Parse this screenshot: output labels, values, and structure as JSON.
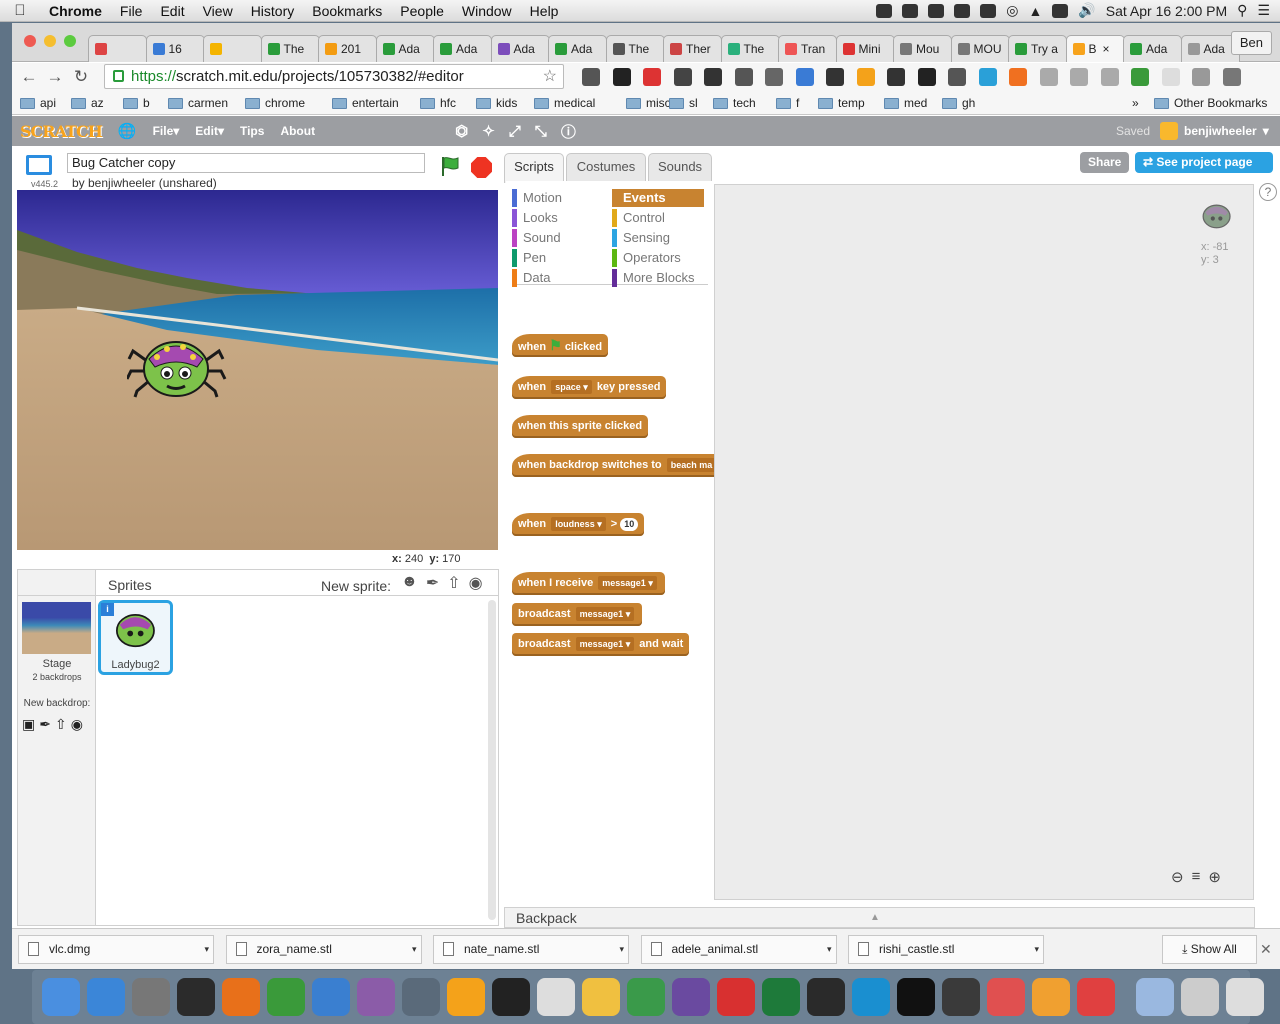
{
  "menubar": {
    "app": "Chrome",
    "items": [
      "File",
      "Edit",
      "View",
      "History",
      "Bookmarks",
      "People",
      "Window",
      "Help"
    ],
    "clock": "Sat Apr 16  2:00 PM"
  },
  "browser": {
    "tabs": [
      "",
      "16",
      "",
      "The",
      "201",
      "Ada",
      "Ada",
      "Ada",
      "Ada",
      "The",
      "Ther",
      "The",
      "Tran",
      "Mini",
      "Mou",
      "MOU",
      "Try a",
      "B",
      "Ada",
      "Ada"
    ],
    "tab_colors": [
      "#d44",
      "#3a7bd5",
      "#f4b400",
      "#2a9c3b",
      "#f39c12",
      "#2a9c3b",
      "#2a9c3b",
      "#7c4dbb",
      "#2a9c3b",
      "#555",
      "#c44",
      "#2ab07c",
      "#e55",
      "#d33",
      "#777",
      "#777",
      "#2a9c3b",
      "#f7a31c",
      "#2a9c3b",
      "#999"
    ],
    "active_tab": 17,
    "profile": "Ben",
    "url_scheme": "https://",
    "url_rest": "scratch.mit.edu/projects/105730382/#editor",
    "bookmarks": [
      "api",
      "az",
      "b",
      "carmen",
      "chrome",
      "entertain",
      "hfc",
      "kids",
      "medical",
      "misc",
      "sl",
      "tech",
      "f",
      "temp",
      "med",
      "gh"
    ],
    "other_bookmarks": "Other Bookmarks",
    "chevron": "»"
  },
  "scratch": {
    "logo": "SCRATCH",
    "menu": [
      "File",
      "Edit",
      "Tips",
      "About"
    ],
    "saved": "Saved",
    "user": "benjiwheeler",
    "project_title": "Bug Catcher copy",
    "byline": "by benjiwheeler (unshared)",
    "version": "v445.2",
    "stage_x_label": "x:",
    "stage_x": "240",
    "stage_y_label": "y:",
    "stage_y": "170",
    "tabs": [
      "Scripts",
      "Costumes",
      "Sounds"
    ],
    "share": "Share",
    "see_project": "See project page",
    "categories_left": [
      "Motion",
      "Looks",
      "Sound",
      "Pen",
      "Data"
    ],
    "categories_right": [
      "Events",
      "Control",
      "Sensing",
      "Operators",
      "More Blocks"
    ],
    "cat_colors_left": [
      "#4a6cd4",
      "#8a55d7",
      "#bb42c3",
      "#0e9a6c",
      "#ee7d16"
    ],
    "cat_colors_right": [
      "#c88330",
      "#e1a91a",
      "#2ca5e2",
      "#5cb712",
      "#632d99"
    ],
    "blocks": {
      "flag_when": "when",
      "flag_clicked": "clicked",
      "key_when": "when",
      "key_value": "space",
      "key_pressed": "key pressed",
      "sprite_clicked": "when this sprite clicked",
      "backdrop_switch": "when backdrop switches to",
      "backdrop_value": "beach ma",
      "loud_when": "when",
      "loud_value": "loudness",
      "loud_op": ">",
      "loud_num": "10",
      "receive_when": "when I receive",
      "receive_value": "message1",
      "broadcast": "broadcast",
      "broadcast_value": "message1",
      "bw_broadcast": "broadcast",
      "bw_value": "message1",
      "bw_wait": "and wait"
    },
    "sprite_x": "x: -81",
    "sprite_y": "y: 3",
    "sprites_header": "Sprites",
    "new_sprite": "New sprite:",
    "stage_label": "Stage",
    "stage_backdrops": "2 backdrops",
    "new_backdrop": "New backdrop:",
    "sprite_name": "Ladybug2",
    "backpack": "Backpack"
  },
  "downloads": [
    "vlc.dmg",
    "zora_name.stl",
    "nate_name.stl",
    "adele_animal.stl",
    "rishi_castle.stl"
  ],
  "show_all": "Show All",
  "dock_colors": [
    "#4a8fe0",
    "#3b86d8",
    "#777",
    "#2b2b2b",
    "#e8701a",
    "#3a9a3a",
    "#3a7fd0",
    "#8b5ca8",
    "#5a6a7a",
    "#f4a21a",
    "#222",
    "#ddd",
    "#f0c040",
    "#3a9a4a",
    "#6a4aa0",
    "#d83030",
    "#1e7a3a",
    "#2a2a2a",
    "#1a8fd0",
    "#111",
    "#3a3a3a",
    "#e05050",
    "#f0a030",
    "#e04040",
    "#9ab8e0",
    "#ccc",
    "#ddd"
  ]
}
